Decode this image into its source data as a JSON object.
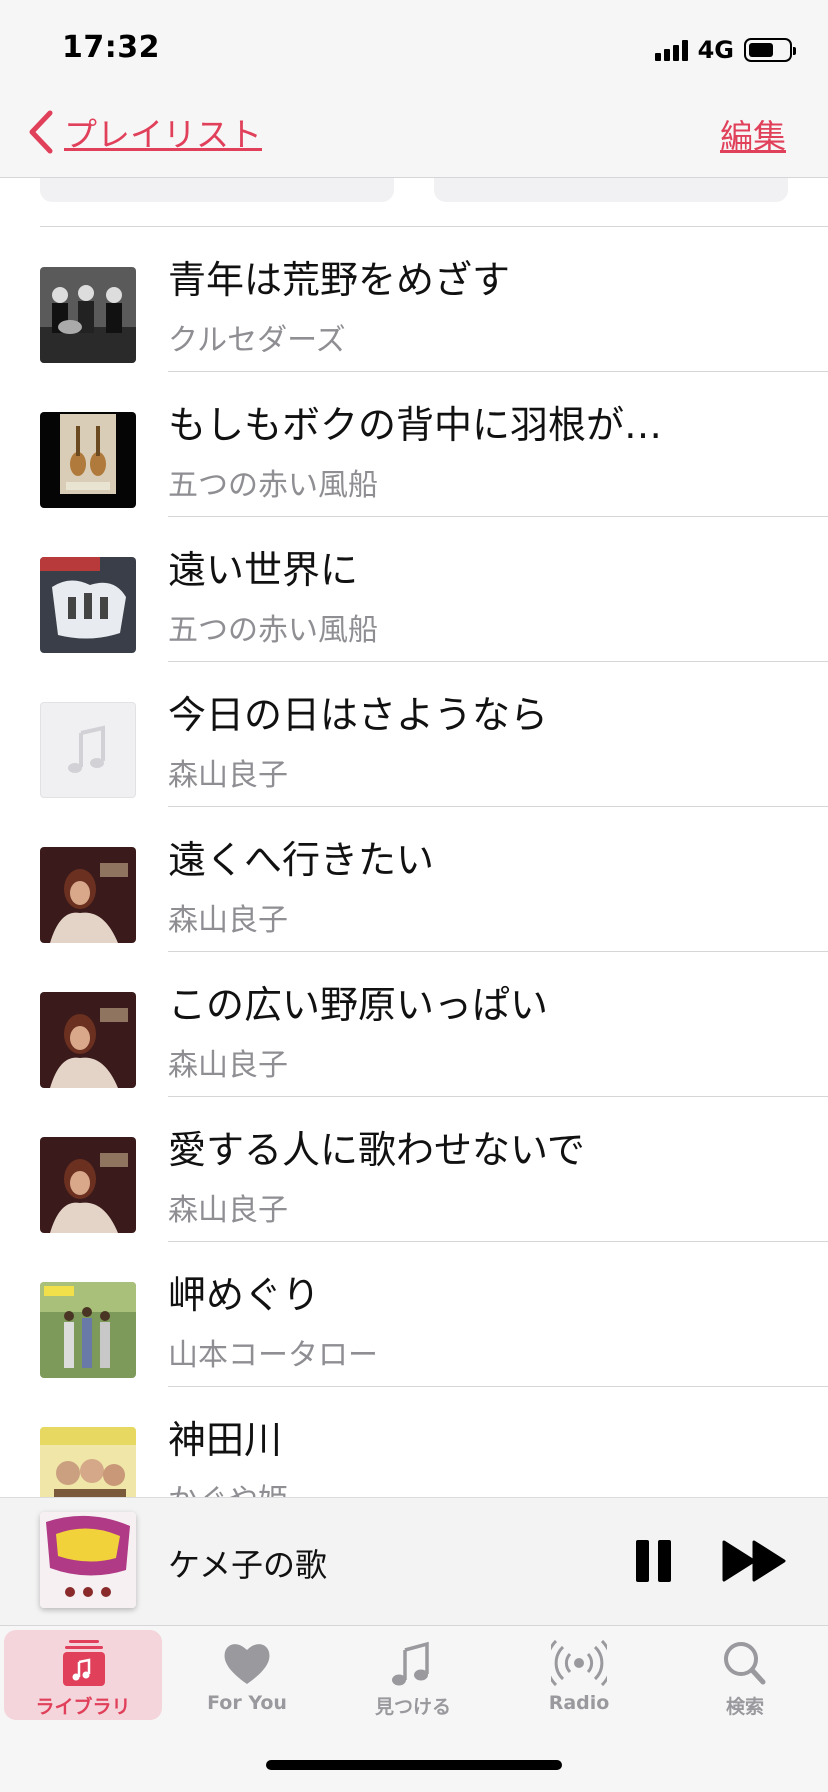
{
  "status": {
    "time": "17:32",
    "network": "4G"
  },
  "nav": {
    "back_label": "プレイリスト",
    "edit_label": "編集"
  },
  "songs": [
    {
      "title": "青年は荒野をめざす",
      "artist": "クルセダーズ"
    },
    {
      "title": "もしもボクの背中に羽根が…",
      "artist": "五つの赤い風船"
    },
    {
      "title": "遠い世界に",
      "artist": "五つの赤い風船"
    },
    {
      "title": "今日の日はさようなら",
      "artist": "森山良子"
    },
    {
      "title": "遠くへ行きたい",
      "artist": "森山良子"
    },
    {
      "title": "この広い野原いっぱい",
      "artist": "森山良子"
    },
    {
      "title": "愛する人に歌わせないで",
      "artist": "森山良子"
    },
    {
      "title": "岬めぐり",
      "artist": "山本コータロー"
    },
    {
      "title": "神田川",
      "artist": "かぐや姫"
    }
  ],
  "now_playing": {
    "title": "ケメ子の歌"
  },
  "tabs": [
    {
      "label": "ライブラリ",
      "icon": "library-icon",
      "active": true
    },
    {
      "label": "For You",
      "icon": "heart-icon"
    },
    {
      "label": "見つける",
      "icon": "music-note-icon"
    },
    {
      "label": "Radio",
      "icon": "radio-icon"
    },
    {
      "label": "検索",
      "icon": "search-icon"
    }
  ],
  "colors": {
    "accent": "#e0405a",
    "secondary_text": "#8e8e93"
  }
}
